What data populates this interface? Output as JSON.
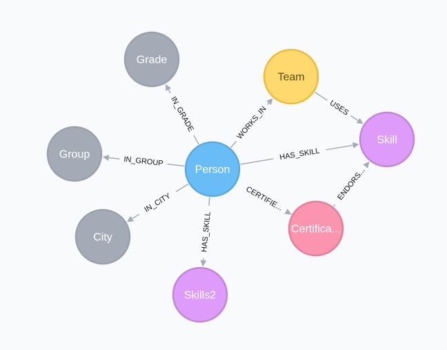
{
  "graph": {
    "background": "#f9fafc",
    "nodes": [
      {
        "id": "person",
        "label": "Person",
        "fill": "#68bdf6",
        "stroke": "#5ca8db",
        "text": "#ffffff"
      },
      {
        "id": "grade",
        "label": "Grade",
        "fill": "#a5abb6",
        "stroke": "#9aa1ac",
        "text": "#ffffff"
      },
      {
        "id": "team",
        "label": "Team",
        "fill": "#ffd86e",
        "stroke": "#edba39",
        "text": "#604a0e"
      },
      {
        "id": "skill",
        "label": "Skill",
        "fill": "#de9bf9",
        "stroke": "#bf85d6",
        "text": "#ffffff"
      },
      {
        "id": "group",
        "label": "Group",
        "fill": "#a5abb6",
        "stroke": "#9aa1ac",
        "text": "#ffffff"
      },
      {
        "id": "city",
        "label": "City",
        "fill": "#a5abb6",
        "stroke": "#9aa1ac",
        "text": "#ffffff"
      },
      {
        "id": "skills2",
        "label": "Skills2",
        "fill": "#de9bf9",
        "stroke": "#bf85d6",
        "text": "#ffffff"
      },
      {
        "id": "certification",
        "label": "Certifica...",
        "fill": "#fb95af",
        "stroke": "#e07f98",
        "text": "#ffffff"
      }
    ],
    "relationships": [
      {
        "from": "person",
        "to": "grade",
        "label": "IN_GRADE"
      },
      {
        "from": "person",
        "to": "team",
        "label": "WORKS_IN"
      },
      {
        "from": "team",
        "to": "skill",
        "label": "USES"
      },
      {
        "from": "person",
        "to": "skill",
        "label": "HAS_SKILL"
      },
      {
        "from": "person",
        "to": "group",
        "label": "IN_GROUP"
      },
      {
        "from": "person",
        "to": "city",
        "label": "IN_CITY"
      },
      {
        "from": "person",
        "to": "skills2",
        "label": "HAS_SKILL"
      },
      {
        "from": "person",
        "to": "certification",
        "label": "CERTIFIE..."
      },
      {
        "from": "certification",
        "to": "skill",
        "label": "ENDORS..."
      }
    ]
  }
}
